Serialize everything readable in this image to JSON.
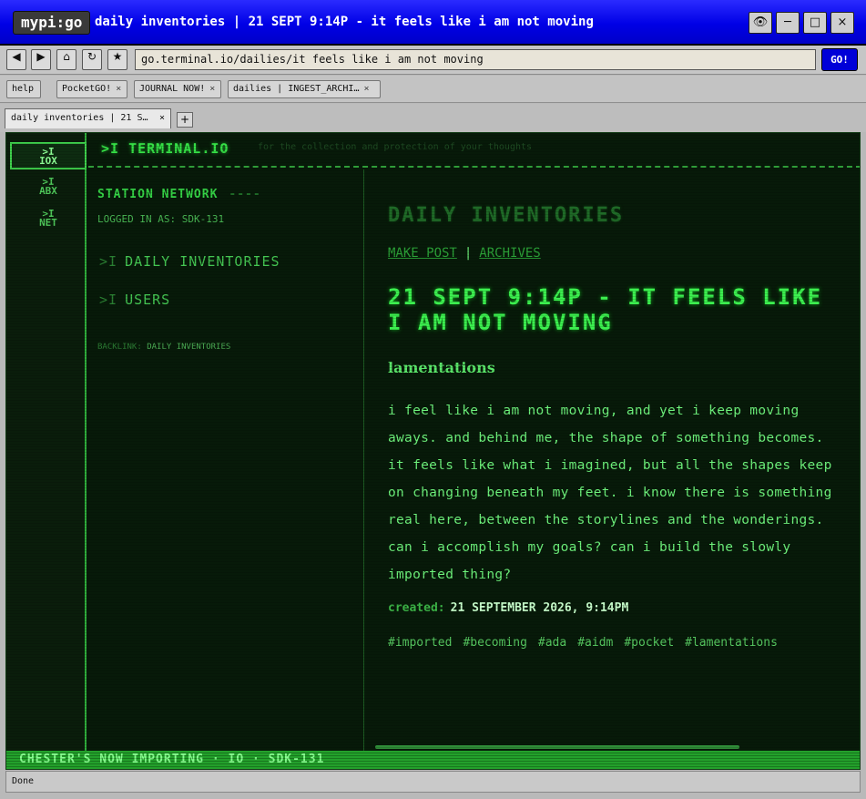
{
  "window": {
    "app_name": "mypi:go",
    "title": "daily inventories | 21 SEPT 9:14P - it feels like i am not moving",
    "buttons": {
      "view": "👁",
      "minimize": "─",
      "maximize": "□",
      "close": "×"
    }
  },
  "navigation": {
    "back": "◀",
    "forward": "▶",
    "home": "⌂",
    "reload": "↻",
    "bookmark": "★",
    "url": "go.terminal.io/dailies/it feels like i am not moving",
    "go_label": "GO!"
  },
  "bookmarks": [
    {
      "label": "help",
      "closable": false
    },
    {
      "label": "PocketGO!",
      "closable": true
    },
    {
      "label": "JOURNAL NOW!",
      "closable": true
    },
    {
      "label": "dailies | INGEST_ARCHI…",
      "closable": true
    }
  ],
  "tabs": [
    {
      "label": "daily inventories | 21 S…"
    }
  ],
  "new_tab_label": "+",
  "close_glyph": "×",
  "rail": [
    {
      "prefix": ">I",
      "label": "IOX",
      "active": true
    },
    {
      "prefix": ">I",
      "label": "ABX",
      "active": false
    },
    {
      "prefix": ">I",
      "label": "NET",
      "active": false
    }
  ],
  "header": {
    "brand": ">I TERMINAL.IO",
    "tagline": "for the collection and protection of your thoughts"
  },
  "sidebar": {
    "station": "STATION NETWORK",
    "station_rule": "----",
    "logged_in": "LOGGED IN AS: SDK-131",
    "nav_prefix": ">I",
    "nav": [
      "DAILY INVENTORIES",
      "USERS"
    ],
    "backlink_label": "BACKLINK:",
    "backlink_value": "DAILY INVENTORIES"
  },
  "main": {
    "page_title": "DAILY INVENTORIES",
    "make_post": "MAKE POST",
    "separator": "|",
    "archives": "ARCHIVES",
    "post_title": "21 SEPT 9:14P - IT FEELS LIKE I AM NOT MOVING",
    "category": "lamentations",
    "body": "i feel like i am not moving, and yet i keep moving aways. and behind me, the shape of something becomes. it feels like what i imagined, but all the shapes keep on changing beneath my feet. i know there is something real here, between the storylines and the wonderings. can i accomplish my goals? can i build the slowly imported thing?",
    "created_label": "created:",
    "created_value": "21 SEPTEMBER 2026, 9:14PM",
    "tags": [
      "#imported",
      "#becoming",
      "#ada",
      "#aidm",
      "#pocket",
      "#lamentations"
    ]
  },
  "statusline": "CHESTER'S NOW IMPORTING · IO · SDK-131",
  "browser_status": "Done"
}
